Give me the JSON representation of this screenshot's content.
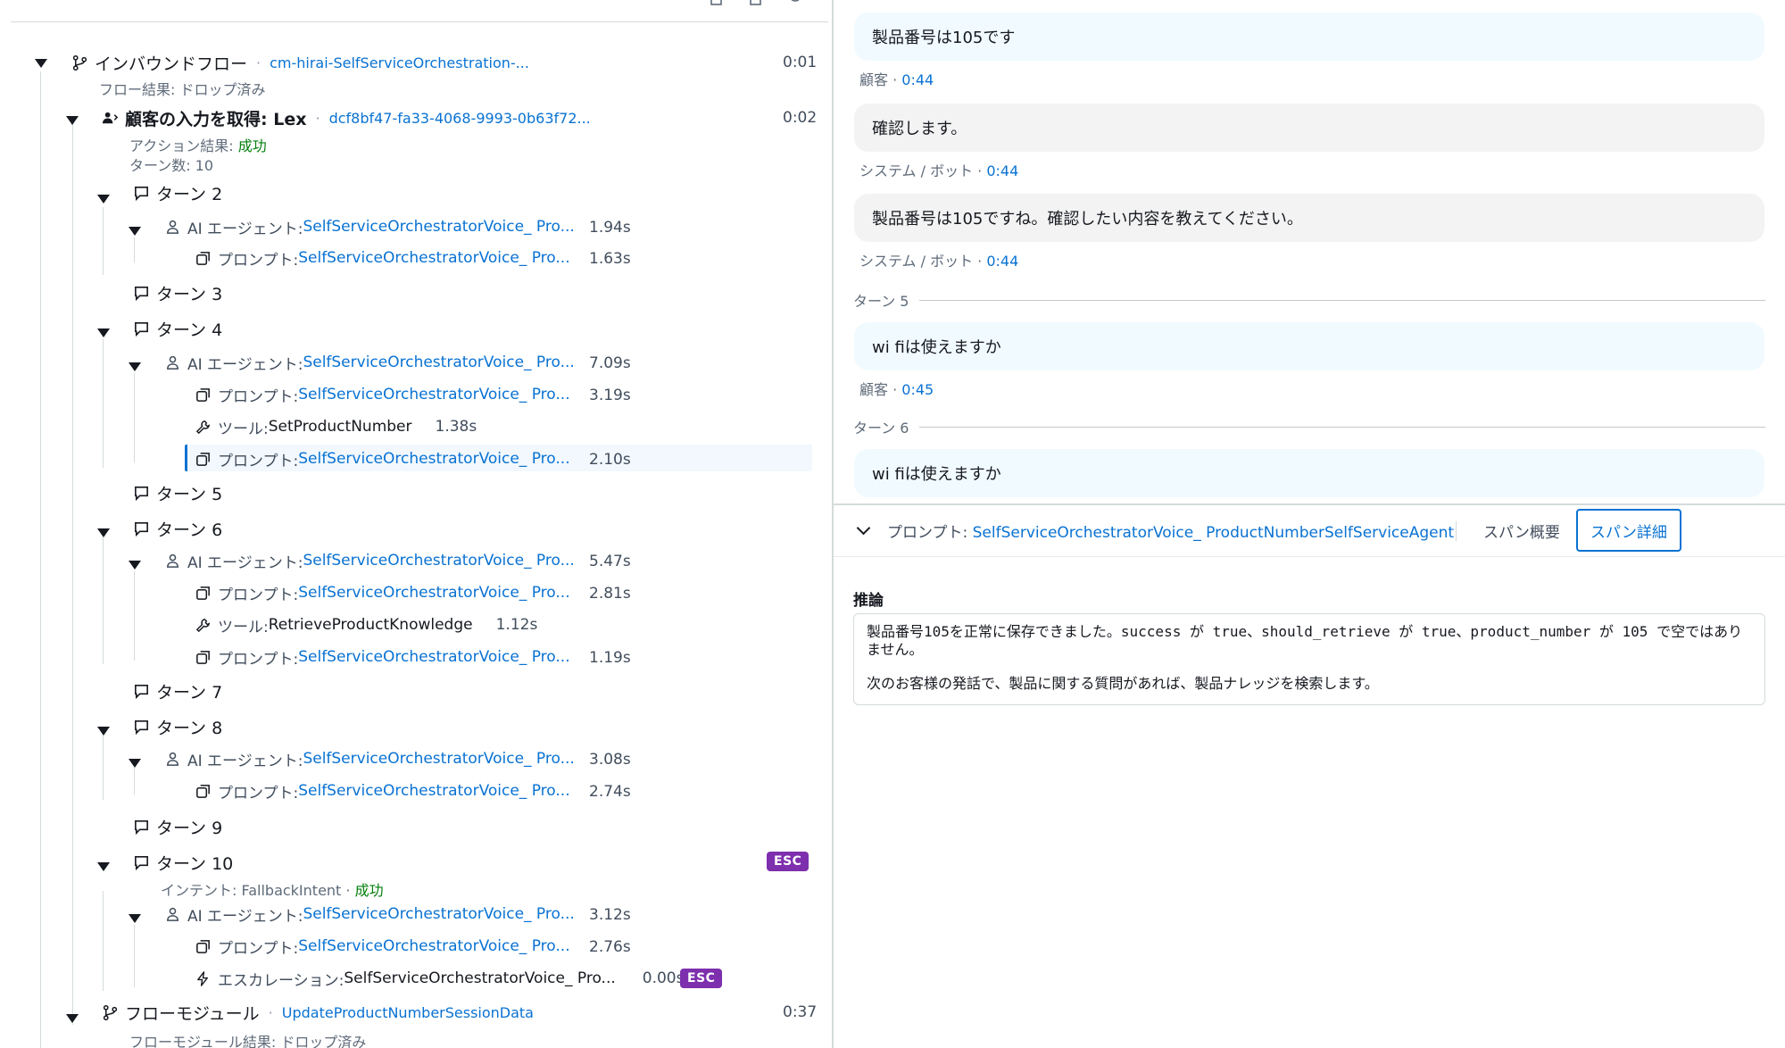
{
  "tree": {
    "inbound": {
      "label": "インバウンドフロー",
      "link": "cm-hirai-SelfServiceOrchestration-...",
      "time": "0:01",
      "result_label": "フロー結果: ドロップ済み"
    },
    "lex": {
      "label": "顧客の入力を取得: Lex",
      "link": "dcf8bf47-fa33-4068-9993-0b63f72...",
      "time": "0:02",
      "result_prefix": "アクション結果: ",
      "result_value": "成功",
      "turns_label": "ターン数: 10"
    },
    "ai_agent_label": "AI エージェント: ",
    "prompt_label": "プロンプト: ",
    "tool_label": "ツール: ",
    "agent_link": "SelfServiceOrchestratorVoice_ Pro...",
    "turns": [
      {
        "label": "ターン 2"
      },
      {
        "label": "ターン 3"
      },
      {
        "label": "ターン 4"
      },
      {
        "label": "ターン 5"
      },
      {
        "label": "ターン 6"
      },
      {
        "label": "ターン 7"
      },
      {
        "label": "ターン 8"
      },
      {
        "label": "ターン 9"
      },
      {
        "label": "ターン 10",
        "badge": "ESC",
        "intent_prefix": "インテント: FallbackIntent · ",
        "intent_status": "成功"
      }
    ],
    "t2": {
      "agent_dur": "1.94s",
      "prompt_dur": "1.63s"
    },
    "t4": {
      "agent_dur": "7.09s",
      "prompt1_dur": "3.19s",
      "tool_name": "SetProductNumber",
      "tool_dur": "1.38s",
      "prompt2_dur": "2.10s"
    },
    "t6": {
      "agent_dur": "5.47s",
      "prompt1_dur": "2.81s",
      "tool_name": "RetrieveProductKnowledge",
      "tool_dur": "1.12s",
      "prompt2_dur": "1.19s"
    },
    "t8": {
      "agent_dur": "3.08s",
      "prompt_dur": "2.74s"
    },
    "t10": {
      "agent_dur": "3.12s",
      "prompt_dur": "2.76s",
      "esc_label": "エスカレーション: ",
      "esc_name": "SelfServiceOrchestratorVoice_ Pro...",
      "esc_dur": "0.00s",
      "esc_badge": "ESC"
    },
    "flow_module": {
      "label": "フローモジュール",
      "link": "UpdateProductNumberSessionData",
      "time": "0:37",
      "result_label": "フローモジュール結果: ドロップ済み"
    }
  },
  "transcript": {
    "messages": [
      {
        "text": "製品番号は105です",
        "speaker": "顧客",
        "time": "0:44"
      },
      {
        "text": "確認します。",
        "speaker": "システム / ボット",
        "time": "0:44"
      },
      {
        "text": "製品番号は105ですね。確認したい内容を教えてください。",
        "speaker": "システム / ボット",
        "time": "0:44"
      },
      {
        "text": "wi fiは使えますか",
        "speaker": "顧客",
        "time": "0:45"
      },
      {
        "text": "wi fiは使えますか"
      }
    ],
    "turn_seps": [
      "ターン 5",
      "ターン 6"
    ]
  },
  "detail": {
    "title_prefix": "プロンプト: ",
    "title_link": "SelfServiceOrchestratorVoice_ ProductNumberSelfServiceAgent",
    "tabs": [
      "スパン概要",
      "スパン詳細"
    ],
    "active_tab": "スパン詳細",
    "reasoning_label": "推論",
    "reasoning_p1": "製品番号105を正常に保存できました。success が true、should_retrieve が true、product_number が 105 で空ではありません。",
    "reasoning_p2": "次のお客様の発話で、製品に関する質問があれば、製品ナレッジを検索します。"
  }
}
